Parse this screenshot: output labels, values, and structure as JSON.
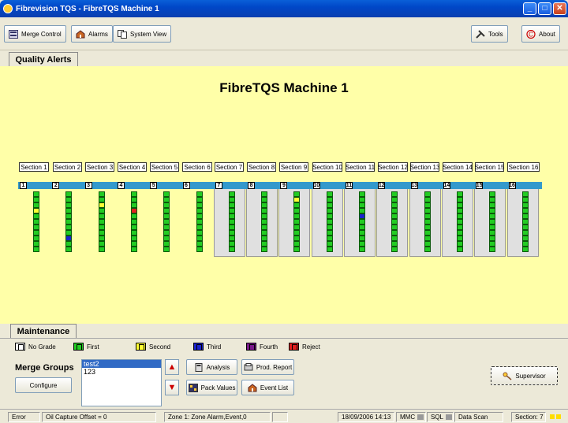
{
  "window": {
    "title": "Fibrevision TQS - FibreTQS Machine 1"
  },
  "toolbar": {
    "merge": "Merge Control",
    "alarms": "Alarms",
    "system": "System View",
    "tools": "Tools",
    "about": "About"
  },
  "tabs": {
    "quality": "Quality Alerts",
    "maintenance": "Maintenance"
  },
  "page": {
    "title": "FibreTQS Machine 1"
  },
  "sections": [
    "Section 1",
    "Section 2",
    "Section 3",
    "Section 4",
    "Section 5",
    "Section 6",
    "Section 7",
    "Section 8",
    "Section 9",
    "Section 10",
    "Section 11",
    "Section 12",
    "Section 13",
    "Section 14",
    "Section 15",
    "Section 16"
  ],
  "units": [
    "1",
    "2",
    "3",
    "4",
    "5",
    "6",
    "7",
    "8",
    "9",
    "10",
    "11",
    "12",
    "13",
    "14",
    "15",
    "16"
  ],
  "cell_states": {
    "1": {
      "3": "Second"
    },
    "2": {
      "8": "Third"
    },
    "3": {
      "2": "Second"
    },
    "4": {
      "3": "Reject"
    },
    "9": {
      "1": "Second"
    },
    "11": {
      "4": "Third"
    }
  },
  "legend": [
    {
      "label": "No Grade",
      "color": "#ffffff"
    },
    {
      "label": "First",
      "color": "#22cc22"
    },
    {
      "label": "Second",
      "color": "#ffff33"
    },
    {
      "label": "Third",
      "color": "#1a22cc"
    },
    {
      "label": "Fourth",
      "color": "#7a1a8a"
    },
    {
      "label": "Reject",
      "color": "#e02020"
    }
  ],
  "merge_groups": {
    "title": "Merge Groups",
    "configure": "Configure",
    "items": [
      "test2",
      "123"
    ]
  },
  "actions": {
    "analysis": "Analysis",
    "prod_report": "Prod. Report",
    "pack_values": "Pack Values",
    "event_list": "Event List",
    "supervisor": "Supervisor"
  },
  "status": {
    "error": "Error",
    "offset": "Oil Capture Offset = 0",
    "zone": "Zone 1: Zone Alarm,Event,0",
    "datetime": "18/09/2006 14:13",
    "mmc": "MMC",
    "sql": "SQL",
    "scan": "Data Scan",
    "section": "Section: 7"
  }
}
